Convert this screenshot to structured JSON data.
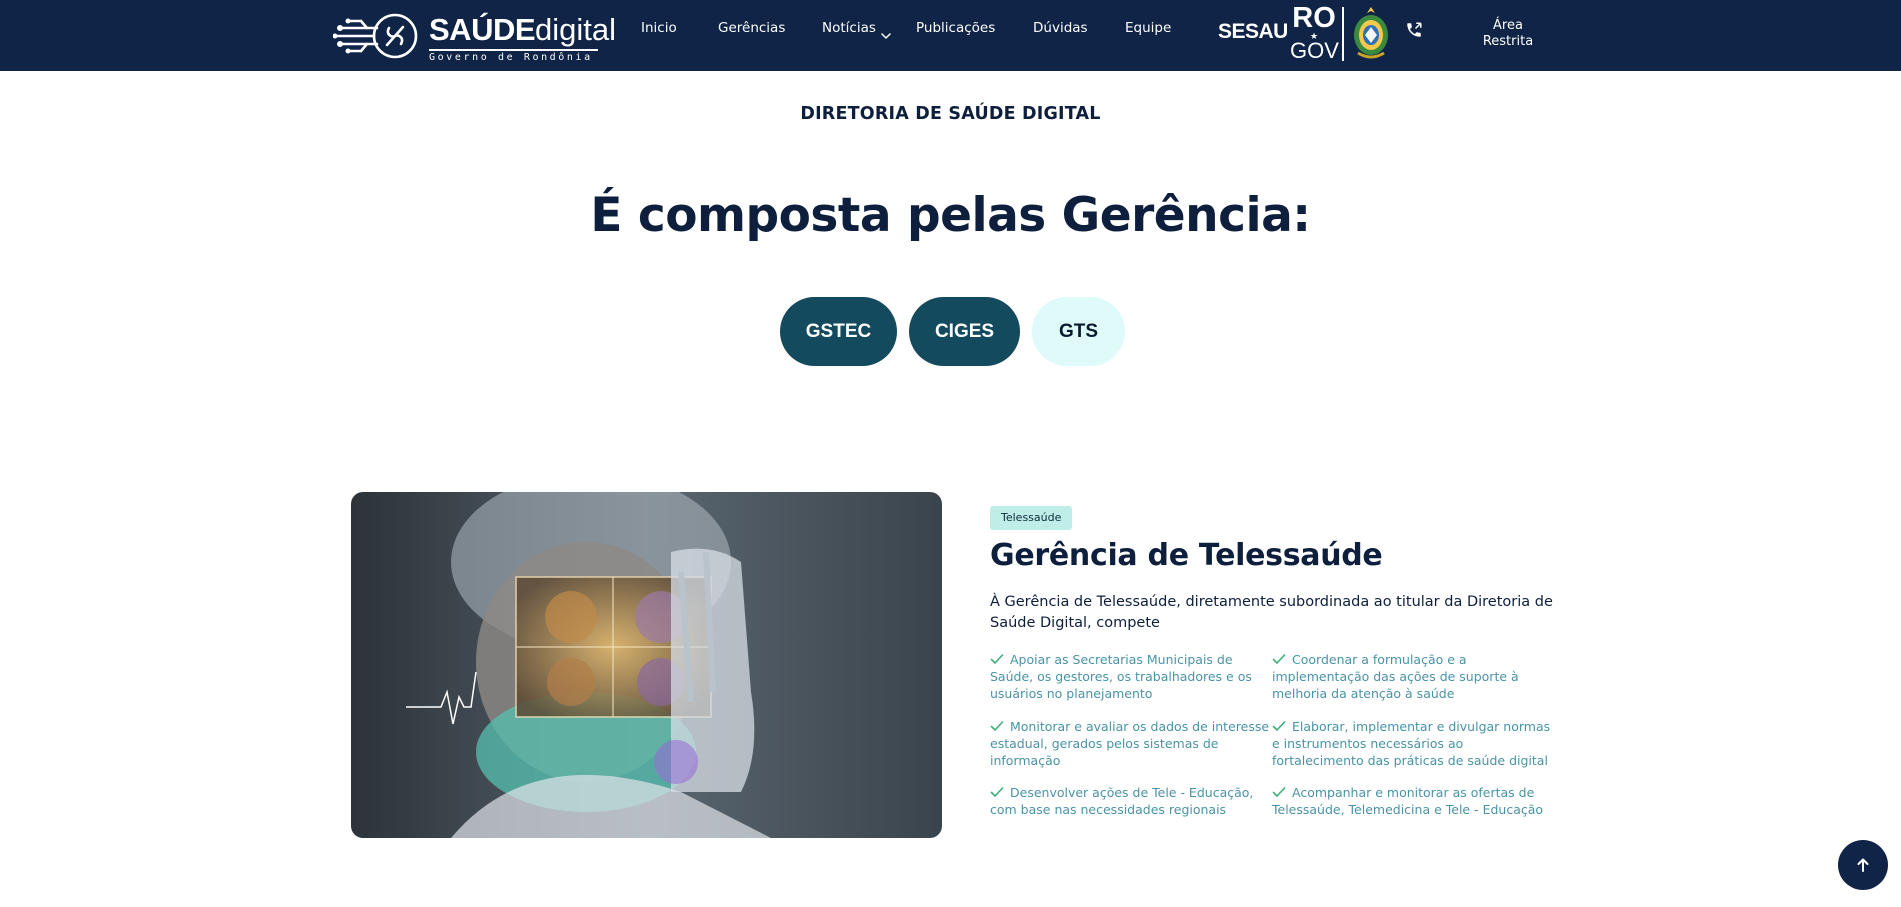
{
  "header": {
    "logo": {
      "brand_bold": "SAÚDE",
      "brand_light": "digital",
      "subtitle": "Governo de Rondônia"
    },
    "nav": [
      "Inicio",
      "Gerências",
      "Notícias",
      "Publicações",
      "Dúvidas",
      "Equipe"
    ],
    "sesau": "SESAU",
    "ro": "RO",
    "gov": "GOV",
    "area_restrita": "Área Restrita",
    "icons": {
      "logo": "circuit-stethoscope-icon",
      "dropdown": "chevron-down-icon",
      "brasao": "state-coat-of-arms-icon",
      "phone": "phone-icon"
    }
  },
  "main": {
    "eyebrow": "DIRETORIA DE SAÚDE DIGITAL",
    "heading": "É composta pelas Gerência:",
    "tabs": [
      {
        "label": "GSTEC",
        "active": false
      },
      {
        "label": "CIGES",
        "active": false
      },
      {
        "label": "GTS",
        "active": true
      }
    ]
  },
  "section": {
    "tag": "Telessaúde",
    "title": "Gerência de Telessaúde",
    "description": "À Gerência de Telessaúde, diretamente subordinada ao titular da Diretoria de Saúde Digital, compete",
    "features": [
      "Apoiar as Secretarias Municipais de Saúde, os gestores, os trabalhadores e os usuários no planejamento",
      "Coordenar a formulação e a implementação das ações de suporte à melhoria da atenção à saúde",
      "Monitorar e avaliar os dados de interesse estadual, gerados pelos sistemas de informação",
      "Elaborar, implementar e divulgar normas e instrumentos necessários ao fortalecimento das práticas de saúde digital",
      "Desenvolver ações de Tele - Educação, com base nas necessidades regionais",
      "Acompanhar e monitorar as ofertas de Telessaúde, Telemedicina e Tele - Educação"
    ],
    "image": "doctor-holding-brain-scan-image"
  },
  "colors": {
    "navbar": "#0f2446",
    "heading": "#0d1f3c",
    "pill_dark": "#134a5e",
    "pill_active": "#defbfa",
    "feature_text": "#4a93a6",
    "tag_bg": "#bfede7"
  }
}
